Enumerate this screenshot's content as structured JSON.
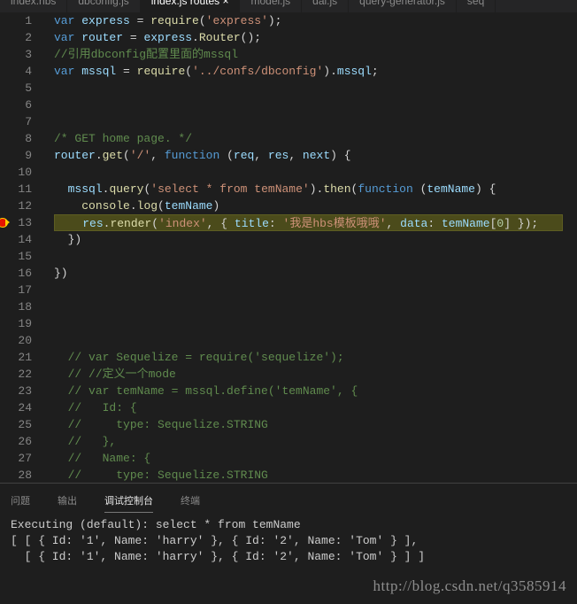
{
  "tabs": [
    {
      "label": "index.hbs",
      "active": false
    },
    {
      "label": "dbconfig.js",
      "active": false
    },
    {
      "label": "index.js routes ×",
      "active": true
    },
    {
      "label": "model.js",
      "active": false
    },
    {
      "label": "dal.js",
      "active": false
    },
    {
      "label": "query-generator.js",
      "active": false
    },
    {
      "label": "seq",
      "active": false
    }
  ],
  "editor": {
    "breakpoint_line": 13,
    "highlight_line": 13,
    "lines": [
      [
        [
          "kw",
          "var "
        ],
        [
          "var",
          "express"
        ],
        [
          "pl",
          " = "
        ],
        [
          "fn",
          "require"
        ],
        [
          "pl",
          "("
        ],
        [
          "str",
          "'express'"
        ],
        [
          "pl",
          ");"
        ]
      ],
      [
        [
          "kw",
          "var "
        ],
        [
          "var",
          "router"
        ],
        [
          "pl",
          " = "
        ],
        [
          "var",
          "express"
        ],
        [
          "pl",
          "."
        ],
        [
          "fn",
          "Router"
        ],
        [
          "pl",
          "();"
        ]
      ],
      [
        [
          "cm",
          "//引用dbconfig配置里面的mssql"
        ]
      ],
      [
        [
          "kw",
          "var "
        ],
        [
          "var",
          "mssql"
        ],
        [
          "pl",
          " = "
        ],
        [
          "fn",
          "require"
        ],
        [
          "pl",
          "("
        ],
        [
          "str",
          "'../confs/dbconfig'"
        ],
        [
          "pl",
          ")."
        ],
        [
          "var",
          "mssql"
        ],
        [
          "pl",
          ";"
        ]
      ],
      [],
      [],
      [],
      [
        [
          "cm",
          "/* GET home page. */"
        ]
      ],
      [
        [
          "var",
          "router"
        ],
        [
          "pl",
          "."
        ],
        [
          "fn",
          "get"
        ],
        [
          "pl",
          "("
        ],
        [
          "str",
          "'/'"
        ],
        [
          "pl",
          ", "
        ],
        [
          "kw",
          "function"
        ],
        [
          "pl",
          " ("
        ],
        [
          "var",
          "req"
        ],
        [
          "pl",
          ", "
        ],
        [
          "var",
          "res"
        ],
        [
          "pl",
          ", "
        ],
        [
          "var",
          "next"
        ],
        [
          "pl",
          ") {"
        ]
      ],
      [],
      [
        [
          "pl",
          "  "
        ],
        [
          "var",
          "mssql"
        ],
        [
          "pl",
          "."
        ],
        [
          "fn",
          "query"
        ],
        [
          "pl",
          "("
        ],
        [
          "str",
          "'select * from temName'"
        ],
        [
          "pl",
          ")."
        ],
        [
          "fn",
          "then"
        ],
        [
          "pl",
          "("
        ],
        [
          "kw",
          "function"
        ],
        [
          "pl",
          " ("
        ],
        [
          "var",
          "temName"
        ],
        [
          "pl",
          ") {"
        ]
      ],
      [
        [
          "pl",
          "    "
        ],
        [
          "fn",
          "console"
        ],
        [
          "pl",
          "."
        ],
        [
          "fn",
          "log"
        ],
        [
          "pl",
          "("
        ],
        [
          "var",
          "temName"
        ],
        [
          "pl",
          ")"
        ]
      ],
      [
        [
          "pl",
          "    "
        ],
        [
          "var",
          "res"
        ],
        [
          "pl",
          "."
        ],
        [
          "fn",
          "render"
        ],
        [
          "pl",
          "("
        ],
        [
          "str",
          "'index'"
        ],
        [
          "pl",
          ", { "
        ],
        [
          "var",
          "title"
        ],
        [
          "pl",
          ": "
        ],
        [
          "str",
          "'我是hbs模板哦哦'"
        ],
        [
          "pl",
          ", "
        ],
        [
          "var",
          "data"
        ],
        [
          "pl",
          ": "
        ],
        [
          "var",
          "temName"
        ],
        [
          "pl",
          "["
        ],
        [
          "num",
          "0"
        ],
        [
          "pl",
          "] });"
        ]
      ],
      [
        [
          "pl",
          "  })"
        ]
      ],
      [],
      [
        [
          "pl",
          "})"
        ]
      ],
      [],
      [],
      [],
      [],
      [
        [
          "pl",
          "  "
        ],
        [
          "cm",
          "// var Sequelize = require('sequelize');"
        ]
      ],
      [
        [
          "pl",
          "  "
        ],
        [
          "cm",
          "// //定义一个mode"
        ]
      ],
      [
        [
          "pl",
          "  "
        ],
        [
          "cm",
          "// var temName = mssql.define('temName', {"
        ]
      ],
      [
        [
          "pl",
          "  "
        ],
        [
          "cm",
          "//   Id: {"
        ]
      ],
      [
        [
          "pl",
          "  "
        ],
        [
          "cm",
          "//     type: Sequelize.STRING"
        ]
      ],
      [
        [
          "pl",
          "  "
        ],
        [
          "cm",
          "//   },"
        ]
      ],
      [
        [
          "pl",
          "  "
        ],
        [
          "cm",
          "//   Name: {"
        ]
      ],
      [
        [
          "pl",
          "  "
        ],
        [
          "cm",
          "//     type: Sequelize.STRING"
        ]
      ]
    ]
  },
  "panel": {
    "tabs": [
      {
        "label": "问题",
        "active": false
      },
      {
        "label": "输出",
        "active": false
      },
      {
        "label": "调试控制台",
        "active": true
      },
      {
        "label": "终端",
        "active": false
      }
    ],
    "output": [
      "Executing (default): select * from temName",
      "[ [ { Id: '1', Name: 'harry' }, { Id: '2', Name: 'Tom' } ],",
      "  [ { Id: '1', Name: 'harry' }, { Id: '2', Name: 'Tom' } ] ]"
    ]
  },
  "watermark": "http://blog.csdn.net/q3585914"
}
